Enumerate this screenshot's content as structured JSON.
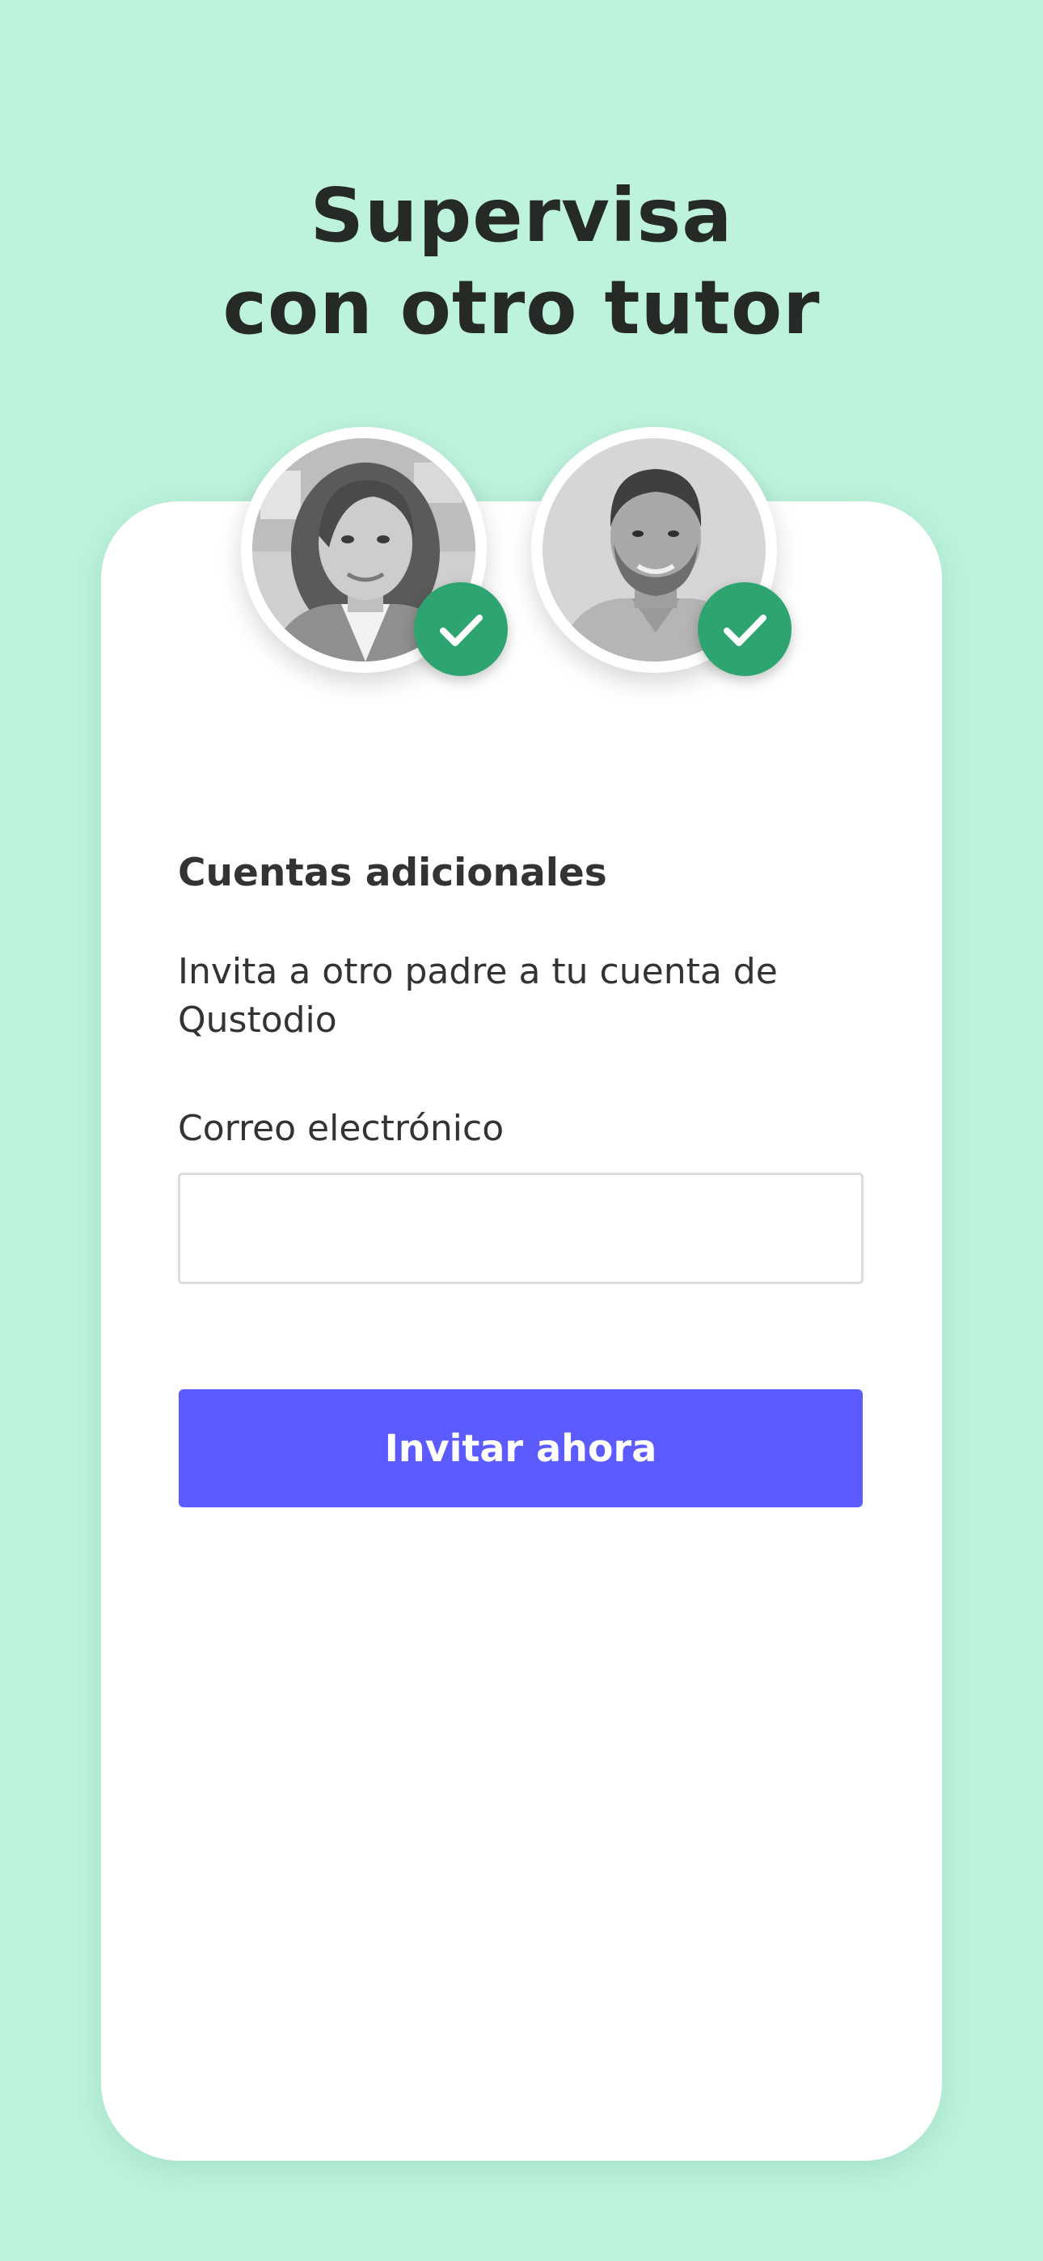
{
  "hero": {
    "title_line1": "Supervisa",
    "title_line2": "con otro tutor"
  },
  "avatars": [
    {
      "name": "avatar-woman",
      "verified": true,
      "icon": "check-icon"
    },
    {
      "name": "avatar-man",
      "verified": true,
      "icon": "check-icon"
    }
  ],
  "form": {
    "section_title": "Cuentas adicionales",
    "description": "Invita a otro padre a tu cuenta de Qustodio",
    "email_label": "Correo electrónico",
    "email_value": "",
    "email_placeholder": "",
    "submit_label": "Invitar ahora"
  },
  "colors": {
    "background": "#bdf3dc",
    "card": "#ffffff",
    "accent_button": "#5b5bff",
    "check_badge": "#2ea571",
    "text": "#333333"
  }
}
